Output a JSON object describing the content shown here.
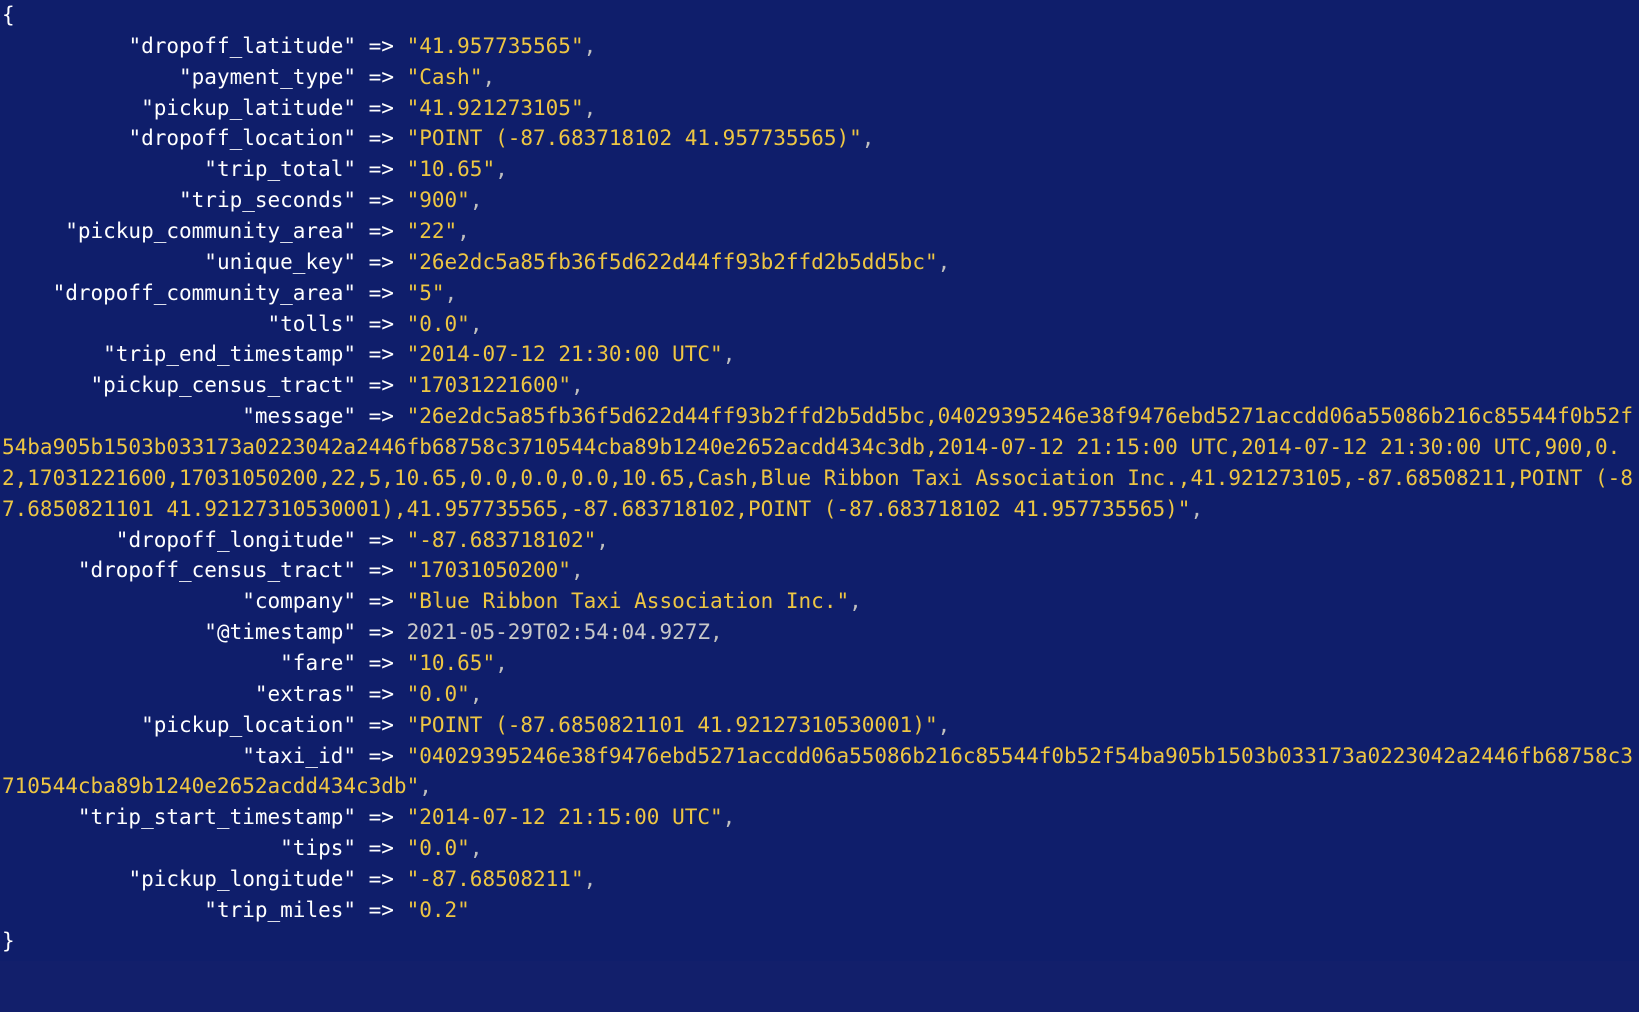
{
  "delimiters": {
    "open": "{",
    "close": "}",
    "arrow": " => ",
    "comma": ","
  },
  "entries": [
    {
      "key": "dropoff_latitude",
      "value": "41.957735565",
      "quoted": true,
      "trailing_comma": true
    },
    {
      "key": "payment_type",
      "value": "Cash",
      "quoted": true,
      "trailing_comma": true
    },
    {
      "key": "pickup_latitude",
      "value": "41.921273105",
      "quoted": true,
      "trailing_comma": true
    },
    {
      "key": "dropoff_location",
      "value": "POINT (-87.683718102 41.957735565)",
      "quoted": true,
      "trailing_comma": true
    },
    {
      "key": "trip_total",
      "value": "10.65",
      "quoted": true,
      "trailing_comma": true
    },
    {
      "key": "trip_seconds",
      "value": "900",
      "quoted": true,
      "trailing_comma": true
    },
    {
      "key": "pickup_community_area",
      "value": "22",
      "quoted": true,
      "trailing_comma": true
    },
    {
      "key": "unique_key",
      "value": "26e2dc5a85fb36f5d622d44ff93b2ffd2b5dd5bc",
      "quoted": true,
      "trailing_comma": true
    },
    {
      "key": "dropoff_community_area",
      "value": "5",
      "quoted": true,
      "trailing_comma": true
    },
    {
      "key": "tolls",
      "value": "0.0",
      "quoted": true,
      "trailing_comma": true
    },
    {
      "key": "trip_end_timestamp",
      "value": "2014-07-12 21:30:00 UTC",
      "quoted": true,
      "trailing_comma": true
    },
    {
      "key": "pickup_census_tract",
      "value": "17031221600",
      "quoted": true,
      "trailing_comma": true
    },
    {
      "key": "message",
      "value": "26e2dc5a85fb36f5d622d44ff93b2ffd2b5dd5bc,04029395246e38f9476ebd5271accdd06a55086b216c85544f0b52f54ba905b1503b033173a0223042a2446fb68758c3710544cba89b1240e2652acdd434c3db,2014-07-12 21:15:00 UTC,2014-07-12 21:30:00 UTC,900,0.2,17031221600,17031050200,22,5,10.65,0.0,0.0,0.0,10.65,Cash,Blue Ribbon Taxi Association Inc.,41.921273105,-87.68508211,POINT (-87.6850821101 41.92127310530001),41.957735565,-87.683718102,POINT (-87.683718102 41.957735565)",
      "quoted": true,
      "trailing_comma": true
    },
    {
      "key": "dropoff_longitude",
      "value": "-87.683718102",
      "quoted": true,
      "trailing_comma": true
    },
    {
      "key": "dropoff_census_tract",
      "value": "17031050200",
      "quoted": true,
      "trailing_comma": true
    },
    {
      "key": "company",
      "value": "Blue Ribbon Taxi Association Inc.",
      "quoted": true,
      "trailing_comma": true
    },
    {
      "key": "@timestamp",
      "value": "2021-05-29T02:54:04.927Z",
      "quoted": false,
      "trailing_comma": true
    },
    {
      "key": "fare",
      "value": "10.65",
      "quoted": true,
      "trailing_comma": true
    },
    {
      "key": "extras",
      "value": "0.0",
      "quoted": true,
      "trailing_comma": true
    },
    {
      "key": "pickup_location",
      "value": "POINT (-87.6850821101 41.92127310530001)",
      "quoted": true,
      "trailing_comma": true
    },
    {
      "key": "taxi_id",
      "value": "04029395246e38f9476ebd5271accdd06a55086b216c85544f0b52f54ba905b1503b033173a0223042a2446fb68758c3710544cba89b1240e2652acdd434c3db",
      "quoted": true,
      "trailing_comma": true
    },
    {
      "key": "trip_start_timestamp",
      "value": "2014-07-12 21:15:00 UTC",
      "quoted": true,
      "trailing_comma": true
    },
    {
      "key": "tips",
      "value": "0.0",
      "quoted": true,
      "trailing_comma": true
    },
    {
      "key": "pickup_longitude",
      "value": "-87.68508211",
      "quoted": true,
      "trailing_comma": true
    },
    {
      "key": "trip_miles",
      "value": "0.2",
      "quoted": true,
      "trailing_comma": false
    }
  ],
  "layout": {
    "key_col_width_ch": 24
  }
}
